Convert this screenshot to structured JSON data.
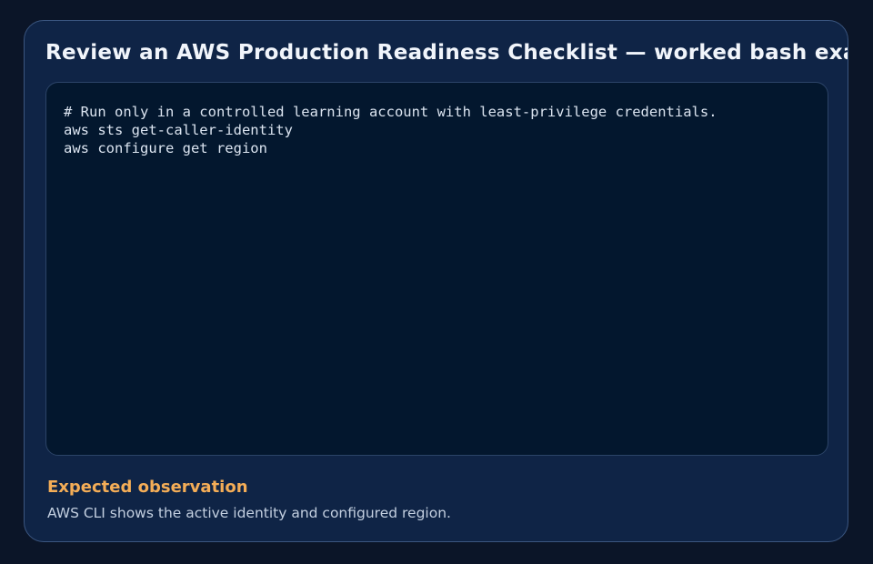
{
  "card": {
    "title": "Review an AWS Production Readiness Checklist — worked bash example"
  },
  "code": {
    "language": "bash",
    "lines": [
      "# Run only in a controlled learning account with least-privilege credentials.",
      "aws sts get-caller-identity",
      "aws configure get region"
    ]
  },
  "observation": {
    "heading": "Expected observation",
    "text": "AWS CLI shows the active identity and configured region."
  },
  "colors": {
    "background": "#0b1528",
    "card": "#0f2446",
    "code_panel": "#03172e",
    "accent": "#f4ad57"
  }
}
